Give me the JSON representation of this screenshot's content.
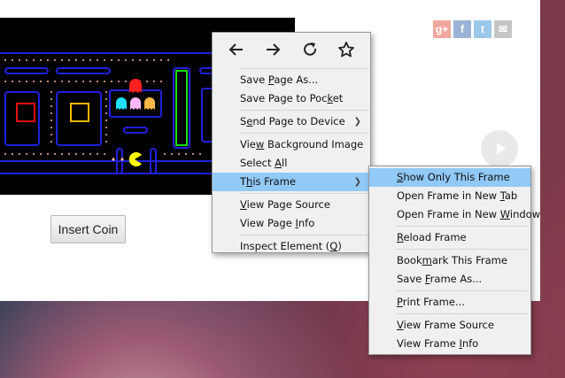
{
  "page": {
    "insert_coin": "Insert Coin",
    "social": {
      "gplus": "g+",
      "facebook": "f",
      "twitter": "t",
      "mail": "✉"
    }
  },
  "context_menu": {
    "nav": [
      "back-icon",
      "forward-icon",
      "reload-icon",
      "bookmark-star-icon"
    ],
    "items": [
      {
        "pre": "Save ",
        "u": "P",
        "post": "age As..."
      },
      {
        "pre": "Save Page to Poc",
        "u": "k",
        "post": "et"
      },
      {
        "pre": "S",
        "u": "e",
        "post": "nd Page to Device"
      },
      {
        "pre": "Vie",
        "u": "w",
        "post": " Background Image"
      },
      {
        "pre": "Select ",
        "u": "A",
        "post": "ll"
      },
      {
        "pre": "T",
        "u": "h",
        "post": "is Frame"
      },
      {
        "pre": "",
        "u": "V",
        "post": "iew Page Source"
      },
      {
        "pre": "View Page ",
        "u": "I",
        "post": "nfo"
      },
      {
        "pre": "Inspect Element (",
        "u": "Q",
        "post": ")"
      }
    ]
  },
  "submenu": {
    "items": [
      {
        "pre": "",
        "u": "S",
        "post": "how Only This Frame"
      },
      {
        "pre": "Open Frame in New ",
        "u": "T",
        "post": "ab"
      },
      {
        "pre": "Open Frame in New ",
        "u": "W",
        "post": "indow"
      },
      {
        "pre": "",
        "u": "R",
        "post": "eload Frame"
      },
      {
        "pre": "Book",
        "u": "m",
        "post": "ark This Frame"
      },
      {
        "pre": "Save ",
        "u": "F",
        "post": "rame As..."
      },
      {
        "pre": "",
        "u": "P",
        "post": "rint Frame..."
      },
      {
        "pre": "",
        "u": "V",
        "post": "iew Frame Source"
      },
      {
        "pre": "View Frame ",
        "u": "I",
        "post": "nfo"
      }
    ]
  },
  "colors": {
    "highlight": "#91c9f7",
    "maze_wall": "#2121de",
    "pacman": "#ffff00"
  }
}
